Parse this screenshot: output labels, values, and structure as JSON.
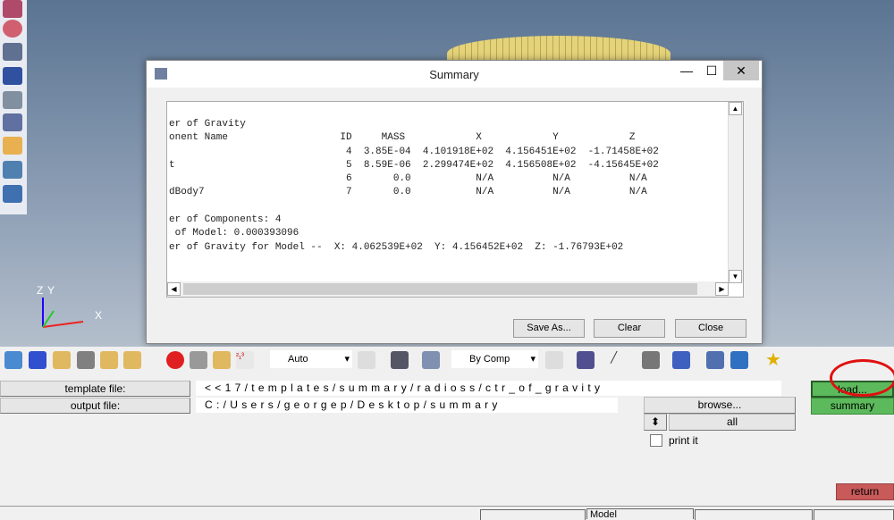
{
  "dialog": {
    "title": "Summary",
    "minimize": "—",
    "maximize": "☐",
    "close": "✕",
    "lines": [
      "er of Gravity",
      "onent Name                   ID     MASS            X            Y            Z",
      "                              4  3.85E-04  4.101918E+02  4.156451E+02  -1.71458E+02",
      "t                             5  8.59E-06  2.299474E+02  4.156508E+02  -4.15645E+02",
      "                              6       0.0           N/A          N/A          N/A",
      "dBody7                        7       0.0           N/A          N/A          N/A",
      "",
      "er of Components: 4",
      " of Model: 0.000393096",
      "er of Gravity for Model --  X: 4.062539E+02  Y: 4.156452E+02  Z: -1.76793E+02"
    ],
    "buttons": {
      "save_as": "Save As...",
      "clear": "Clear",
      "close": "Close"
    }
  },
  "axis": {
    "z": "Z",
    "y": "Y",
    "x": "X"
  },
  "toolbar": {
    "auto": "Auto",
    "by_comp": "By Comp"
  },
  "panel": {
    "template_label": "template file:",
    "template_value": "<<17/templates/summary/radioss/ctr_of_gravity",
    "output_label": "output file:",
    "output_value": "C:/Users/georgep/Desktop/summary",
    "browse": "browse...",
    "all": "all",
    "print_it": "print it",
    "load": "load...",
    "summary": "summary",
    "return": "return"
  },
  "status": {
    "model": "Model"
  },
  "colors": {
    "green": "#5cba5c",
    "return": "#c85a5a",
    "annotation": "#e01010"
  }
}
